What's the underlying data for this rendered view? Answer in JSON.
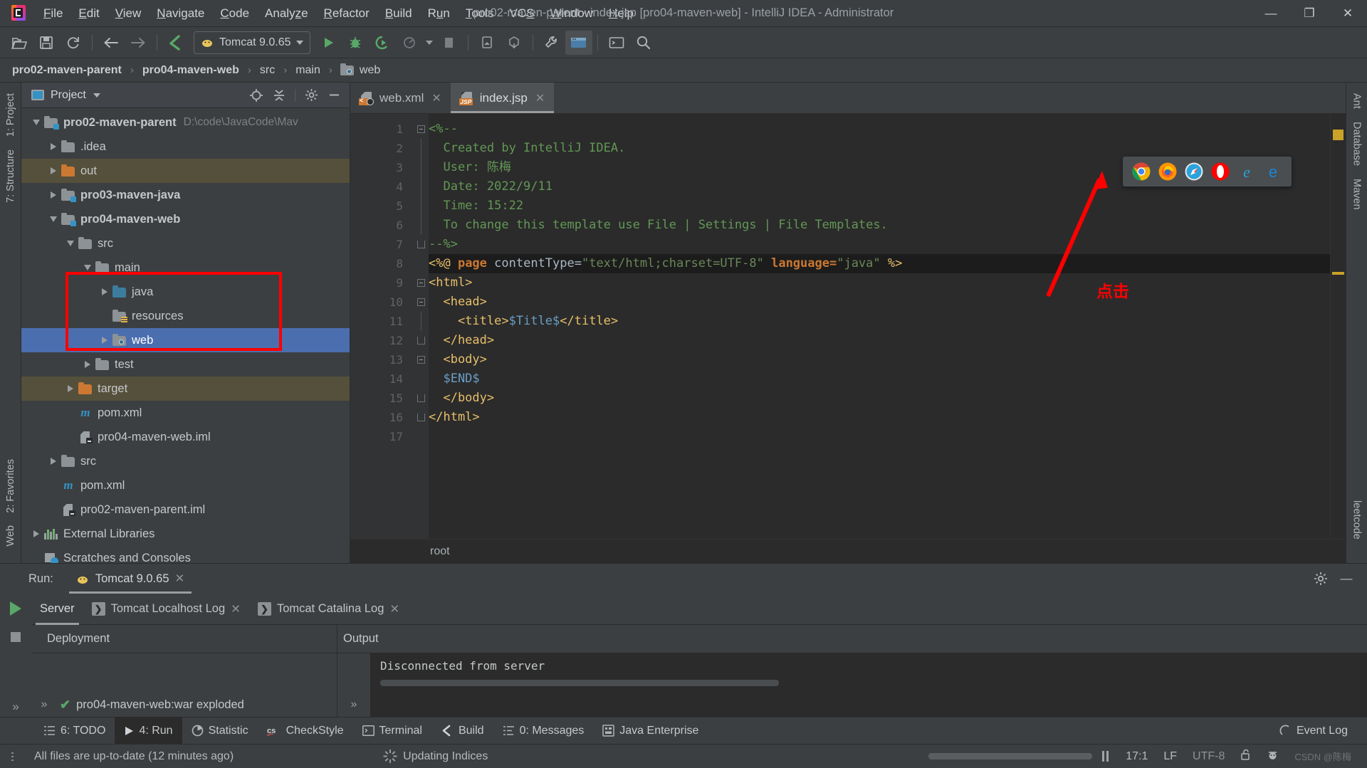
{
  "window": {
    "title": "pro02-maven-parent - index.jsp [pro04-maven-web] - IntelliJ IDEA - Administrator",
    "minimize": "—",
    "maximize": "❐",
    "close": "✕"
  },
  "menubar": {
    "items": [
      {
        "label": "File",
        "mnemonic": "F"
      },
      {
        "label": "Edit",
        "mnemonic": "E"
      },
      {
        "label": "View",
        "mnemonic": "V"
      },
      {
        "label": "Navigate",
        "mnemonic": "N"
      },
      {
        "label": "Code",
        "mnemonic": "C"
      },
      {
        "label": "Analyze",
        "mnemonic": "z"
      },
      {
        "label": "Refactor",
        "mnemonic": "R"
      },
      {
        "label": "Build",
        "mnemonic": "B"
      },
      {
        "label": "Run",
        "mnemonic": "u"
      },
      {
        "label": "Tools",
        "mnemonic": "T"
      },
      {
        "label": "VCS",
        "mnemonic": "S"
      },
      {
        "label": "Window",
        "mnemonic": "W"
      },
      {
        "label": "Help",
        "mnemonic": "H"
      }
    ]
  },
  "toolbar": {
    "open_label": "open-folder",
    "save_label": "save-all",
    "sync_label": "synchronize",
    "back_label": "navigate-back",
    "forward_label": "navigate-forward",
    "build_label": "build-project",
    "run_config": "Tomcat 9.0.65",
    "run_label": "run",
    "debug_label": "debug",
    "run_coverage_label": "run-with-coverage",
    "profile_label": "profiler",
    "stop_label": "stop",
    "device_label": "device-manager",
    "sdk_label": "sdk-manager",
    "settings_label": "settings",
    "browser_label": "open-in-browser",
    "terminal_label": "terminal",
    "search_label": "search-everywhere"
  },
  "breadcrumb": {
    "items": [
      {
        "label": "pro02-maven-parent",
        "bold": true,
        "icon": "none"
      },
      {
        "label": "pro04-maven-web",
        "bold": true,
        "icon": "none"
      },
      {
        "label": "src",
        "bold": false,
        "icon": "none"
      },
      {
        "label": "main",
        "bold": false,
        "icon": "none"
      },
      {
        "label": "web",
        "bold": false,
        "icon": "web-folder"
      }
    ],
    "separator": "›"
  },
  "left_rail": {
    "items": [
      {
        "label": "1: Project",
        "icon": "project-icon"
      },
      {
        "label": "7: Structure",
        "icon": "structure-icon"
      },
      {
        "label": "2: Favorites",
        "icon": "star-icon"
      },
      {
        "label": "Web",
        "icon": "web-icon"
      }
    ]
  },
  "right_rail": {
    "items": [
      {
        "label": "Ant",
        "icon": "ant-icon"
      },
      {
        "label": "Database",
        "icon": "database-icon"
      },
      {
        "label": "Maven",
        "icon": "maven-icon"
      },
      {
        "label": "leetcode",
        "icon": "leetcode-icon"
      }
    ]
  },
  "project_panel": {
    "title": "Project",
    "dropdown_caret": "▾",
    "icons": [
      "locate-icon",
      "collapse-all-icon",
      "settings-gear-icon",
      "hide-icon"
    ],
    "tree": [
      {
        "depth": 0,
        "arrow": "down",
        "icon": "module-folder",
        "label": "pro02-maven-parent",
        "bold": true,
        "path": "D:\\code\\JavaCode\\Mav",
        "state": "normal"
      },
      {
        "depth": 1,
        "arrow": "right",
        "icon": "folder",
        "label": ".idea",
        "bold": false,
        "path": "",
        "state": "normal"
      },
      {
        "depth": 1,
        "arrow": "right",
        "icon": "folder-orange",
        "label": "out",
        "bold": false,
        "path": "",
        "state": "excluded"
      },
      {
        "depth": 1,
        "arrow": "right",
        "icon": "module-folder",
        "label": "pro03-maven-java",
        "bold": true,
        "path": "",
        "state": "normal"
      },
      {
        "depth": 1,
        "arrow": "down",
        "icon": "module-folder",
        "label": "pro04-maven-web",
        "bold": true,
        "path": "",
        "state": "normal"
      },
      {
        "depth": 2,
        "arrow": "down",
        "icon": "folder",
        "label": "src",
        "bold": false,
        "path": "",
        "state": "normal"
      },
      {
        "depth": 3,
        "arrow": "down",
        "icon": "folder",
        "label": "main",
        "bold": false,
        "path": "",
        "state": "normal"
      },
      {
        "depth": 4,
        "arrow": "right",
        "icon": "folder-blue",
        "label": "java",
        "bold": false,
        "path": "",
        "state": "normal"
      },
      {
        "depth": 4,
        "arrow": "none",
        "icon": "folder-resource",
        "label": "resources",
        "bold": false,
        "path": "",
        "state": "normal"
      },
      {
        "depth": 4,
        "arrow": "right",
        "icon": "folder-web",
        "label": "web",
        "bold": false,
        "path": "",
        "state": "selected"
      },
      {
        "depth": 3,
        "arrow": "right",
        "icon": "folder",
        "label": "test",
        "bold": false,
        "path": "",
        "state": "normal"
      },
      {
        "depth": 2,
        "arrow": "right",
        "icon": "folder-orange",
        "label": "target",
        "bold": false,
        "path": "",
        "state": "excluded"
      },
      {
        "depth": 2,
        "arrow": "none",
        "icon": "maven-m",
        "label": "pom.xml",
        "bold": false,
        "path": "",
        "state": "normal"
      },
      {
        "depth": 2,
        "arrow": "none",
        "icon": "iml-file",
        "label": "pro04-maven-web.iml",
        "bold": false,
        "path": "",
        "state": "normal"
      },
      {
        "depth": 1,
        "arrow": "right",
        "icon": "folder",
        "label": "src",
        "bold": false,
        "path": "",
        "state": "normal"
      },
      {
        "depth": 1,
        "arrow": "none",
        "icon": "maven-m",
        "label": "pom.xml",
        "bold": false,
        "path": "",
        "state": "normal"
      },
      {
        "depth": 1,
        "arrow": "none",
        "icon": "iml-file",
        "label": "pro02-maven-parent.iml",
        "bold": false,
        "path": "",
        "state": "normal"
      },
      {
        "depth": 0,
        "arrow": "right",
        "icon": "libraries",
        "label": "External Libraries",
        "bold": false,
        "path": "",
        "state": "normal"
      },
      {
        "depth": 0,
        "arrow": "none",
        "icon": "scratches",
        "label": "Scratches and Consoles",
        "bold": false,
        "path": "",
        "state": "normal"
      }
    ]
  },
  "editor": {
    "tabs": [
      {
        "label": "web.xml",
        "icon": "xml-file-icon",
        "active": false,
        "close": "✕"
      },
      {
        "label": "index.jsp",
        "icon": "jsp-file-icon",
        "active": true,
        "close": "✕"
      }
    ],
    "line_numbers": [
      1,
      2,
      3,
      4,
      5,
      6,
      7,
      8,
      9,
      10,
      11,
      12,
      13,
      14,
      15,
      16,
      17
    ],
    "lines": [
      {
        "n": 1,
        "segs": [
          {
            "t": "<%--",
            "c": "c-comment"
          }
        ]
      },
      {
        "n": 2,
        "segs": [
          {
            "t": "  Created by IntelliJ IDEA.",
            "c": "c-comment"
          }
        ]
      },
      {
        "n": 3,
        "segs": [
          {
            "t": "  User: 陈梅",
            "c": "c-comment"
          }
        ]
      },
      {
        "n": 4,
        "segs": [
          {
            "t": "  Date: 2022/9/11",
            "c": "c-comment"
          }
        ]
      },
      {
        "n": 5,
        "segs": [
          {
            "t": "  Time: 15:22",
            "c": "c-comment"
          }
        ]
      },
      {
        "n": 6,
        "segs": [
          {
            "t": "  To change this template use File | Settings | File Templates.",
            "c": "c-comment"
          }
        ]
      },
      {
        "n": 7,
        "segs": [
          {
            "t": "--%>",
            "c": "c-comment"
          }
        ]
      },
      {
        "n": 8,
        "segs": [
          {
            "t": "<%@ ",
            "c": "c-tag"
          },
          {
            "t": "page ",
            "c": "c-kw"
          },
          {
            "t": "contentType=",
            "c": "c-plain"
          },
          {
            "t": "\"text/html;charset=UTF-8\"",
            "c": "c-str"
          },
          {
            "t": " ",
            "c": "c-plain"
          },
          {
            "t": "language=",
            "c": "c-kw"
          },
          {
            "t": "\"java\"",
            "c": "c-str"
          },
          {
            "t": " %>",
            "c": "c-tag"
          }
        ]
      },
      {
        "n": 9,
        "segs": [
          {
            "t": "<html>",
            "c": "c-tag"
          }
        ]
      },
      {
        "n": 10,
        "segs": [
          {
            "t": "  <head>",
            "c": "c-tag"
          }
        ]
      },
      {
        "n": 11,
        "segs": [
          {
            "t": "    <title>",
            "c": "c-tag"
          },
          {
            "t": "$Title$",
            "c": "c-el"
          },
          {
            "t": "</title>",
            "c": "c-tag"
          }
        ]
      },
      {
        "n": 12,
        "segs": [
          {
            "t": "  </head>",
            "c": "c-tag"
          }
        ]
      },
      {
        "n": 13,
        "segs": [
          {
            "t": "  <body>",
            "c": "c-tag"
          }
        ]
      },
      {
        "n": 14,
        "segs": [
          {
            "t": "  $END$",
            "c": "c-el"
          }
        ]
      },
      {
        "n": 15,
        "segs": [
          {
            "t": "  </body>",
            "c": "c-tag"
          }
        ]
      },
      {
        "n": 16,
        "segs": [
          {
            "t": "</html>",
            "c": "c-tag"
          }
        ]
      },
      {
        "n": 17,
        "segs": [
          {
            "t": "",
            "c": "c-plain"
          }
        ]
      }
    ],
    "status_text": "root"
  },
  "annotation": {
    "text": "点击",
    "color": "#ff0000"
  },
  "browser_popup": {
    "browsers": [
      {
        "name": "chrome-icon"
      },
      {
        "name": "firefox-icon"
      },
      {
        "name": "safari-icon"
      },
      {
        "name": "opera-icon"
      },
      {
        "name": "internet-explorer-icon"
      },
      {
        "name": "edge-icon"
      }
    ]
  },
  "run_panel": {
    "run_label": "Run:",
    "config_tab": "Tomcat 9.0.65",
    "config_close": "✕",
    "settings_icon": "gear-icon",
    "hide_icon": "—",
    "tabs": [
      {
        "label": "Server",
        "active": true,
        "badge": false,
        "close": ""
      },
      {
        "label": "Tomcat Localhost Log",
        "active": false,
        "badge": true,
        "close": "✕"
      },
      {
        "label": "Tomcat Catalina Log",
        "active": false,
        "badge": true,
        "close": "✕"
      }
    ],
    "deployment_header": "Deployment",
    "deployment_item": "pro04-maven-web:war exploded",
    "output_header": "Output",
    "console_text": "Disconnected from server",
    "expand_chevron": "»"
  },
  "tool_strip": {
    "items": [
      {
        "label": "6: TODO",
        "mnemonic": "6",
        "icon": "todo-icon",
        "active": false
      },
      {
        "label": "4: Run",
        "mnemonic": "4",
        "icon": "run-icon",
        "active": true
      },
      {
        "label": "Statistic",
        "mnemonic": "",
        "icon": "statistic-icon",
        "active": false
      },
      {
        "label": "CheckStyle",
        "mnemonic": "",
        "icon": "checkstyle-icon",
        "active": false
      },
      {
        "label": "Terminal",
        "mnemonic": "",
        "icon": "terminal-icon",
        "active": false
      },
      {
        "label": "Build",
        "mnemonic": "",
        "icon": "build-icon",
        "active": false
      },
      {
        "label": "0: Messages",
        "mnemonic": "0",
        "icon": "messages-icon",
        "active": false
      },
      {
        "label": "Java Enterprise",
        "mnemonic": "",
        "icon": "java-enterprise-icon",
        "active": false
      }
    ],
    "event_log": "Event Log"
  },
  "status_bar": {
    "message": "All files are up-to-date (12 minutes ago)",
    "indexing": "Updating Indices",
    "caret_position": "17:1",
    "line_separator": "LF",
    "encoding": "UTF-8",
    "lock_icon": "unlocked-icon",
    "inspector_icon": "inspector-icon",
    "watermark": "CSDN @陈梅"
  }
}
